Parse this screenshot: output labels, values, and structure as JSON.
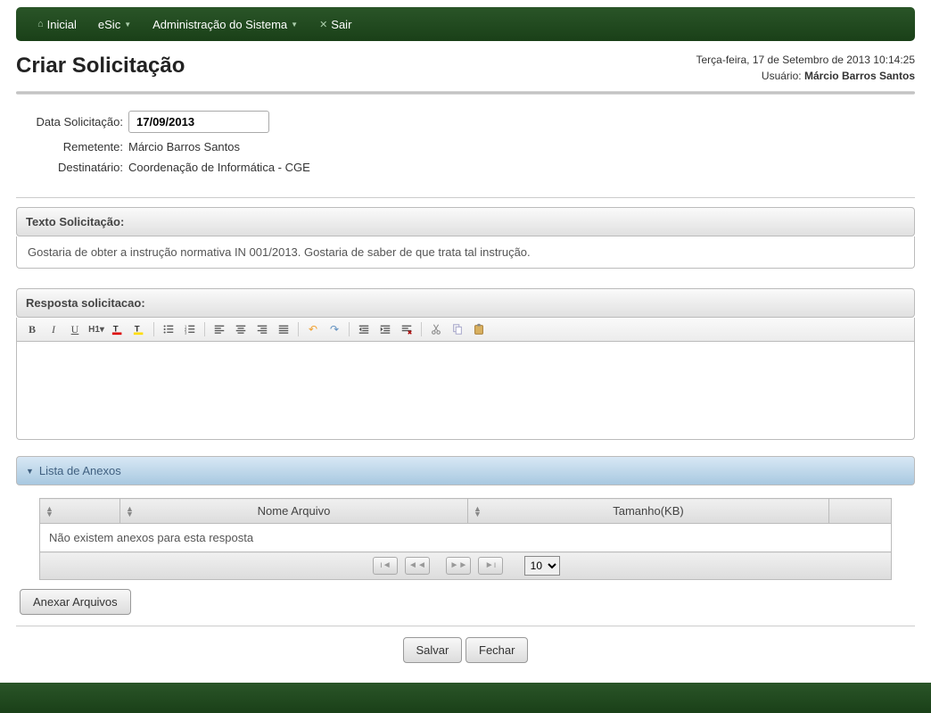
{
  "nav": {
    "inicial": "Inicial",
    "esic": "eSic",
    "admin": "Administração do Sistema",
    "sair": "Sair"
  },
  "header": {
    "title": "Criar Solicitação",
    "datetime": "Terça-feira, 17 de Setembro de 2013 10:14:25",
    "user_label": "Usuário:",
    "user_name": "Márcio Barros Santos"
  },
  "form": {
    "date_label": "Data Solicitação:",
    "date_value": "17/09/2013",
    "remetente_label": "Remetente:",
    "remetente_value": "Márcio Barros Santos",
    "destinatario_label": "Destinatário:",
    "destinatario_value": "Coordenação de Informática - CGE"
  },
  "texto": {
    "header": "Texto Solicitação:",
    "body": "Gostaria de obter a instrução normativa IN 001/2013. Gostaria de saber de que trata tal instrução."
  },
  "resposta": {
    "header": "Resposta solicitacao:"
  },
  "anexos": {
    "header": "Lista de Anexos",
    "col_nome": "Nome Arquivo",
    "col_tamanho": "Tamanho(KB)",
    "empty": "Não existem anexos para esta resposta",
    "page_size": "10",
    "attach_btn": "Anexar Arquivos"
  },
  "actions": {
    "salvar": "Salvar",
    "fechar": "Fechar"
  }
}
